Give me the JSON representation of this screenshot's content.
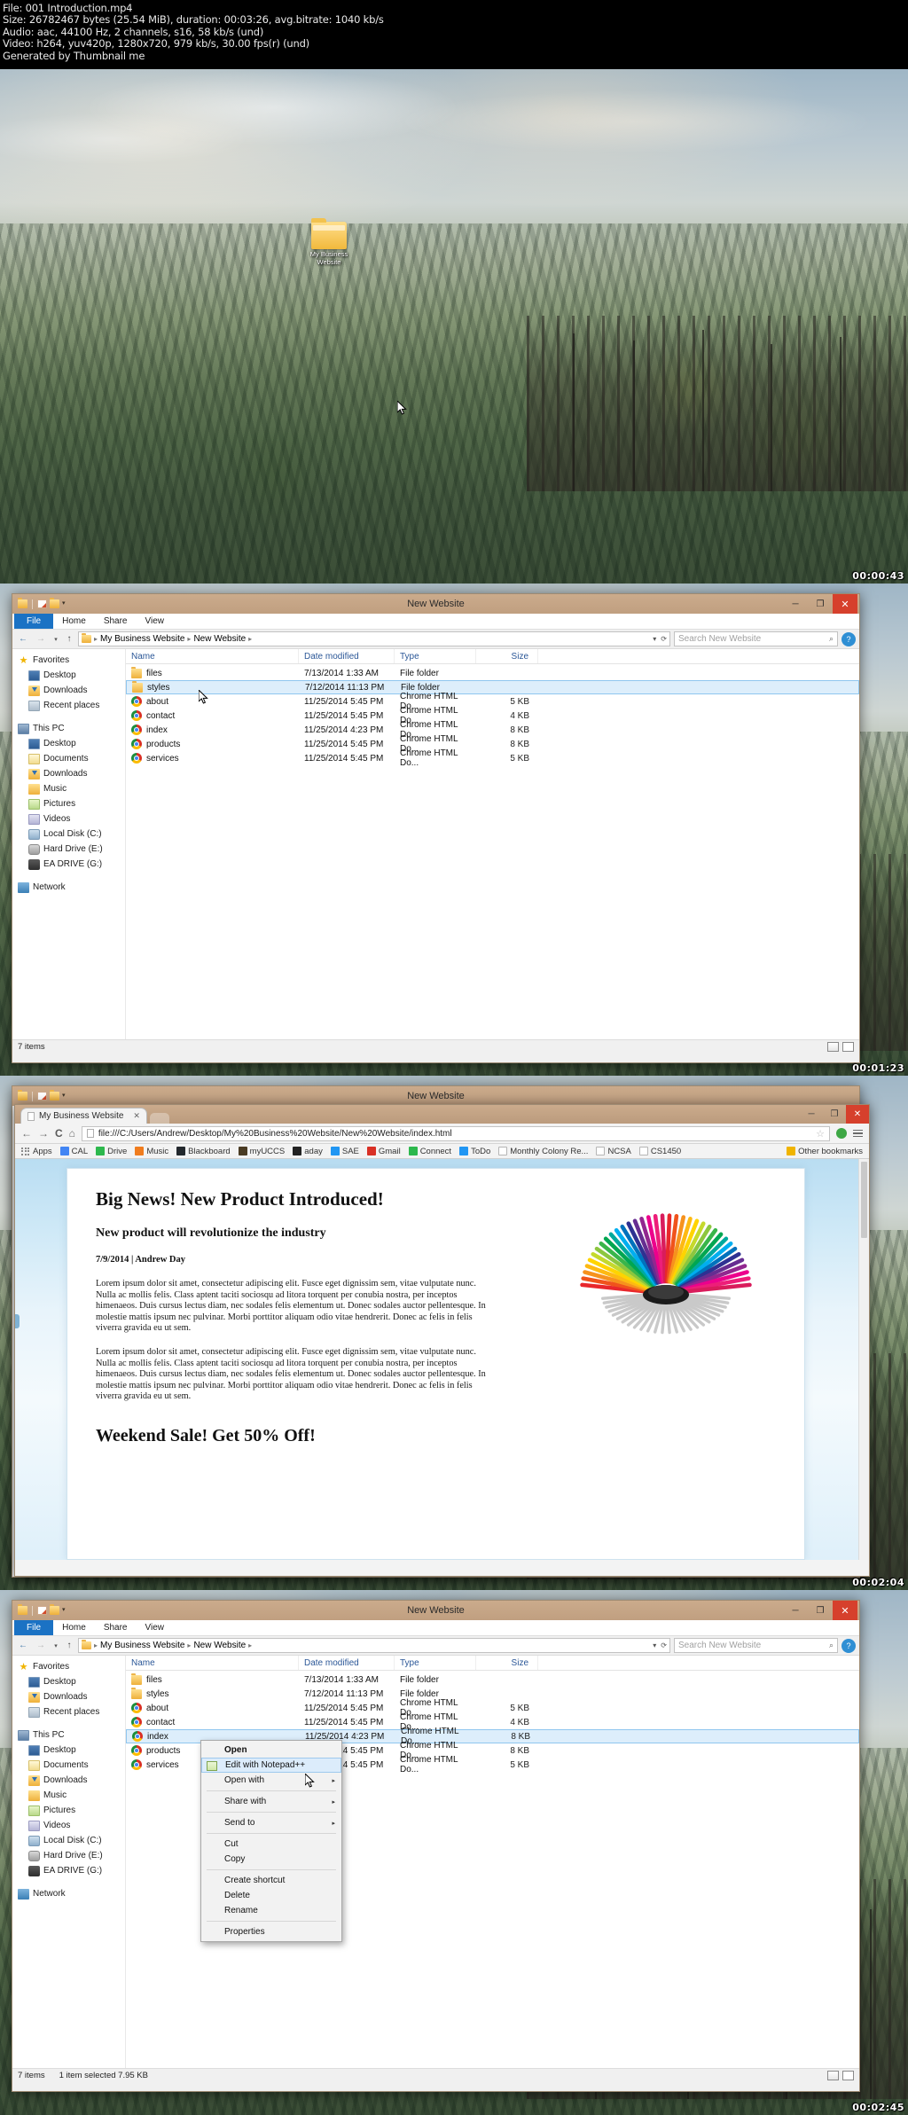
{
  "meta": {
    "line1": "File: 001 Introduction.mp4",
    "line2": "Size: 26782467 bytes (25.54 MiB), duration: 00:03:26, avg.bitrate: 1040 kb/s",
    "line3": "Audio: aac, 44100 Hz, 2 channels, s16, 58 kb/s (und)",
    "line4": "Video: h264, yuv420p, 1280x720, 979 kb/s, 30.00 fps(r) (und)",
    "line5": "Generated by Thumbnail me"
  },
  "frames": [
    {
      "timestamp": "00:00:43"
    },
    {
      "timestamp": "00:01:23"
    },
    {
      "timestamp": "00:02:04"
    },
    {
      "timestamp": "00:02:45"
    }
  ],
  "desktop": {
    "icon_label": "My Business Website"
  },
  "explorer": {
    "title": "New Website",
    "quick_access": {
      "dropdown": "▾"
    },
    "tabs": [
      "File",
      "Home",
      "Share",
      "View"
    ],
    "window_buttons": {
      "minimize": "─",
      "maximize": "❐",
      "close": "✕"
    },
    "breadcrumb": [
      "My Business Website",
      "New Website"
    ],
    "breadcrumb_sep": "▸",
    "refresh_icon": "⟳",
    "dropdown_icon": "▾",
    "search_placeholder": "Search New Website",
    "search_icon": "⌕",
    "help_label": "?",
    "nav_back": "←",
    "nav_fwd": "→",
    "nav_recent": "▾",
    "nav_up": "↑",
    "nav_pane": [
      {
        "label": "Favorites",
        "icon": "star-icon",
        "level": "root"
      },
      {
        "label": "Desktop",
        "icon": "desktop-icon",
        "level": "child"
      },
      {
        "label": "Downloads",
        "icon": "downloads-icon",
        "level": "child"
      },
      {
        "label": "Recent places",
        "icon": "recent-places-icon",
        "level": "child"
      },
      {
        "label": "",
        "icon": "spacer",
        "level": "spacer"
      },
      {
        "label": "This PC",
        "icon": "this-pc-icon",
        "level": "root"
      },
      {
        "label": "Desktop",
        "icon": "desktop-icon",
        "level": "child"
      },
      {
        "label": "Documents",
        "icon": "documents-icon",
        "level": "child"
      },
      {
        "label": "Downloads",
        "icon": "downloads-icon",
        "level": "child"
      },
      {
        "label": "Music",
        "icon": "music-icon",
        "level": "child"
      },
      {
        "label": "Pictures",
        "icon": "pictures-icon",
        "level": "child"
      },
      {
        "label": "Videos",
        "icon": "videos-icon",
        "level": "child"
      },
      {
        "label": "Local Disk (C:)",
        "icon": "local-disk-icon",
        "level": "child"
      },
      {
        "label": "Hard Drive (E:)",
        "icon": "hard-drive-icon",
        "level": "child"
      },
      {
        "label": "EA DRIVE (G:)",
        "icon": "usb-drive-icon",
        "level": "child"
      },
      {
        "label": "",
        "icon": "spacer",
        "level": "spacer"
      },
      {
        "label": "Network",
        "icon": "network-icon",
        "level": "root"
      }
    ],
    "columns": [
      "Name",
      "Date modified",
      "Type",
      "Size"
    ],
    "rows": [
      {
        "name": "files",
        "date": "7/13/2014 1:33 AM",
        "type": "File folder",
        "size": "",
        "icon": "folder-icon"
      },
      {
        "name": "styles",
        "date": "7/12/2014 11:13 PM",
        "type": "File folder",
        "size": "",
        "icon": "folder-icon"
      },
      {
        "name": "about",
        "date": "11/25/2014 5:45 PM",
        "type": "Chrome HTML Do...",
        "size": "5 KB",
        "icon": "chrome-icon"
      },
      {
        "name": "contact",
        "date": "11/25/2014 5:45 PM",
        "type": "Chrome HTML Do...",
        "size": "4 KB",
        "icon": "chrome-icon"
      },
      {
        "name": "index",
        "date": "11/25/2014 4:23 PM",
        "type": "Chrome HTML Do...",
        "size": "8 KB",
        "icon": "chrome-icon"
      },
      {
        "name": "products",
        "date": "11/25/2014 5:45 PM",
        "type": "Chrome HTML Do...",
        "size": "8 KB",
        "icon": "chrome-icon"
      },
      {
        "name": "services",
        "date": "11/25/2014 5:45 PM",
        "type": "Chrome HTML Do...",
        "size": "5 KB",
        "icon": "chrome-icon"
      }
    ],
    "status_frame2": {
      "count": "7 items",
      "selection": ""
    },
    "status_frame4": {
      "count": "7 items",
      "selection": "1 item selected  7.95 KB"
    }
  },
  "chrome": {
    "tab_title": "My Business Website",
    "tab_close": "✕",
    "url": "file:///C:/Users/Andrew/Desktop/My%20Business%20Website/New%20Website/index.html",
    "back": "←",
    "forward": "→",
    "reload": "C",
    "home": "⌂",
    "star": "☆",
    "window_buttons": {
      "minimize": "─",
      "maximize": "❐",
      "close": "✕"
    },
    "bookmarks": [
      {
        "label": "Apps",
        "icon": "apps-grid-icon",
        "color": "#8a8a8a"
      },
      {
        "label": "CAL",
        "icon": "calendar-icon",
        "color": "#4285f4"
      },
      {
        "label": "Drive",
        "icon": "drive-icon",
        "color": "#2db84d"
      },
      {
        "label": "Music",
        "icon": "music-play-icon",
        "color": "#f07c1e"
      },
      {
        "label": "Blackboard",
        "icon": "blackboard-icon",
        "color": "#23282d"
      },
      {
        "label": "myUCCS",
        "icon": "uccs-icon",
        "color": "#4a3b23"
      },
      {
        "label": "aday",
        "icon": "aday-icon",
        "color": "#222222"
      },
      {
        "label": "SAE",
        "icon": "sae-icon",
        "color": "#2196f3"
      },
      {
        "label": "Gmail",
        "icon": "gmail-icon",
        "color": "#d93025"
      },
      {
        "label": "Connect",
        "icon": "connect-icon",
        "color": "#2db84d"
      },
      {
        "label": "ToDo",
        "icon": "todo-icon",
        "color": "#2196f3"
      },
      {
        "label": "Monthly Colony Re...",
        "icon": "doc-icon",
        "color": "#ffffff"
      },
      {
        "label": "NCSA",
        "icon": "page-icon",
        "color": "#ffffff"
      },
      {
        "label": "CS1450",
        "icon": "page-icon",
        "color": "#ffffff"
      }
    ],
    "other_bookmarks": {
      "label": "Other bookmarks",
      "icon": "folder-icon",
      "color": "#f0b400"
    }
  },
  "article": {
    "h1": "Big News! New Product Introduced!",
    "h2": "New product will revolutionize the industry",
    "byline": "7/9/2014 | Andrew Day",
    "p1": "Lorem ipsum dolor sit amet, consectetur adipiscing elit. Fusce eget dignissim sem, vitae vulputate nunc. Nulla ac mollis felis. Class aptent taciti sociosqu ad litora torquent per conubia nostra, per inceptos himenaeos. Duis cursus lectus diam, nec sodales felis elementum ut. Donec sodales auctor pellentesque. In molestie mattis ipsum nec pulvinar. Morbi porttitor aliquam odio vitae hendrerit. Donec ac felis in felis viverra gravida eu ut sem.",
    "p2": "Lorem ipsum dolor sit amet, consectetur adipiscing elit. Fusce eget dignissim sem, vitae vulputate nunc. Nulla ac mollis felis. Class aptent taciti sociosqu ad litora torquent per conubia nostra, per inceptos himenaeos. Duis cursus lectus diam, nec sodales felis elementum ut. Donec sodales auctor pellentesque. In molestie mattis ipsum nec pulvinar. Morbi porttitor aliquam odio vitae hendrerit. Donec ac felis in felis viverra gravida eu ut sem.",
    "h1b": "Weekend Sale! Get 50% Off!"
  },
  "context_menu": {
    "items": [
      {
        "label": "Open",
        "bold": true,
        "submenu": false,
        "highlight": false,
        "icon": ""
      },
      {
        "label": "Edit with Notepad++",
        "bold": false,
        "submenu": false,
        "highlight": true,
        "icon": "notepadpp-icon"
      },
      {
        "label": "Open with",
        "bold": false,
        "submenu": true,
        "highlight": false,
        "icon": ""
      },
      {
        "sep": true
      },
      {
        "label": "Share with",
        "bold": false,
        "submenu": true,
        "highlight": false,
        "icon": ""
      },
      {
        "sep": true
      },
      {
        "label": "Send to",
        "bold": false,
        "submenu": true,
        "highlight": false,
        "icon": ""
      },
      {
        "sep": true
      },
      {
        "label": "Cut",
        "bold": false,
        "submenu": false,
        "highlight": false,
        "icon": ""
      },
      {
        "label": "Copy",
        "bold": false,
        "submenu": false,
        "highlight": false,
        "icon": ""
      },
      {
        "sep": true
      },
      {
        "label": "Create shortcut",
        "bold": false,
        "submenu": false,
        "highlight": false,
        "icon": ""
      },
      {
        "label": "Delete",
        "bold": false,
        "submenu": false,
        "highlight": false,
        "icon": ""
      },
      {
        "label": "Rename",
        "bold": false,
        "submenu": false,
        "highlight": false,
        "icon": ""
      },
      {
        "sep": true
      },
      {
        "label": "Properties",
        "bold": false,
        "submenu": false,
        "highlight": false,
        "icon": ""
      }
    ],
    "submenu_arrow": "▸"
  }
}
